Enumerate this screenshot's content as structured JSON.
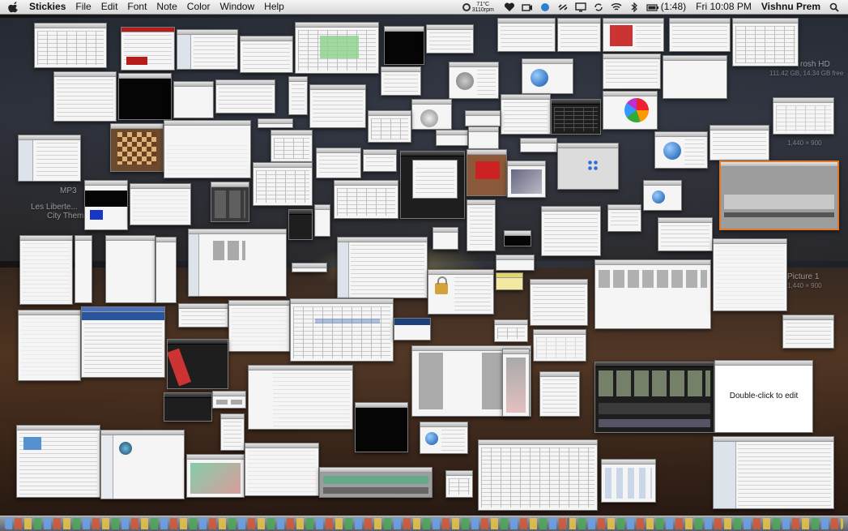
{
  "menubar": {
    "app_name": "Stickies",
    "menus": [
      "File",
      "Edit",
      "Font",
      "Note",
      "Color",
      "Window",
      "Help"
    ],
    "weather_temp": "71°C",
    "weather_rpm": "3110rpm",
    "battery_time": "(1:48)",
    "clock": "Fri 10:08 PM",
    "user_name": "Vishnu Prem"
  },
  "desktop": {
    "drive_label": "rosh HD",
    "drive_sub": "111.42 GB, 14.34 GB free",
    "res1": "1,440 × 900",
    "picture_label": "Picture 1",
    "res2": "1,440 × 900",
    "left_label_1": "MP3",
    "left_label_2": "Les Liberte...",
    "left_label_3": "City Them..."
  },
  "sticky_note": {
    "text": "Double-click to edit"
  },
  "colors": {
    "menubar_bg": "#e6e6e6",
    "window_border": "#7a7a7a",
    "dock_bg": "#7a8088",
    "accent_orange": "#e07a2a",
    "accent_blue": "#3c66b8"
  },
  "icons": [
    "apple-icon",
    "heart-icon",
    "monitor-icon",
    "wifi-icon",
    "bluetooth-icon",
    "battery-icon",
    "spotlight-icon"
  ]
}
